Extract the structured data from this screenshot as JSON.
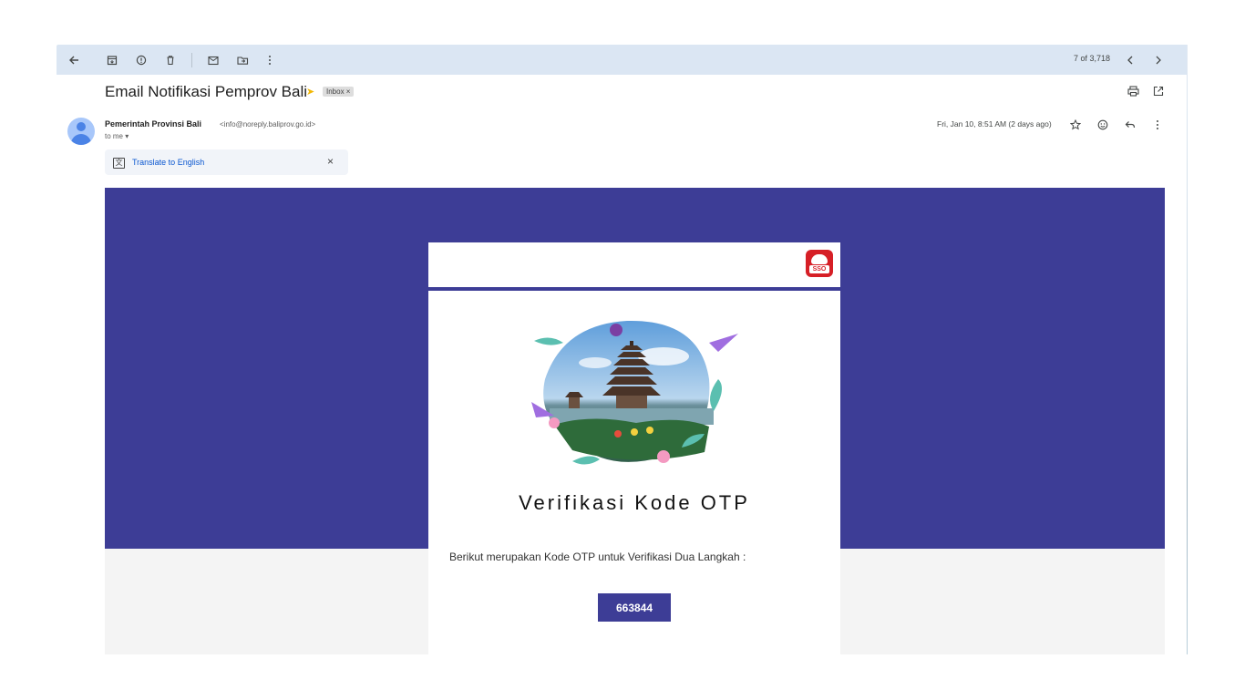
{
  "toolbar": {
    "back_icon": "arrow-left-icon",
    "pager_text": "7 of 3,718"
  },
  "email": {
    "subject": "Email Notifikasi Pemprov Bali",
    "label": "Inbox ×",
    "sender_name": "Pemerintah Provinsi Bali",
    "sender_email": "<info@noreply.baliprov.go.id>",
    "recipient": "to me ▾",
    "date": "Fri, Jan 10, 8:51 AM (2 days ago)"
  },
  "translate": {
    "link": "Translate to English",
    "close": "×"
  },
  "body": {
    "logo_text": "SSO",
    "title": "Verifikasi Kode OTP",
    "description": "Berikut merupakan Kode OTP untuk Verifikasi Dua Langkah :",
    "otp_code": "663844"
  },
  "colors": {
    "brand_purple": "#3d3d96",
    "logo_red": "#d61f26",
    "toolbar_bg": "#dbe6f3",
    "link_blue": "#0b57d0"
  }
}
